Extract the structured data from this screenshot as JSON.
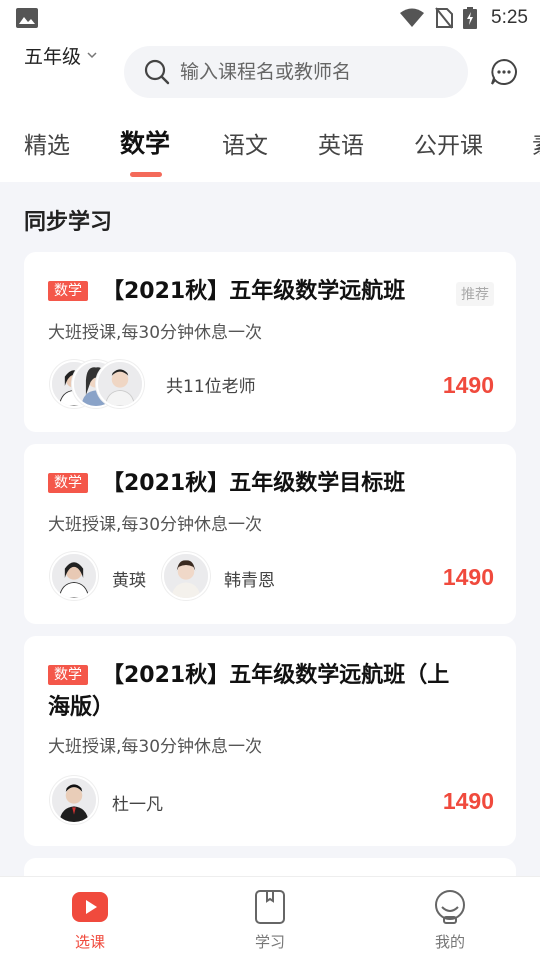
{
  "status_bar": {
    "time": "5:25"
  },
  "header": {
    "grade": "五年级",
    "search_placeholder": "输入课程名或教师名"
  },
  "tabs": [
    {
      "label": "精选",
      "active": false
    },
    {
      "label": "数学",
      "active": true
    },
    {
      "label": "语文",
      "active": false
    },
    {
      "label": "英语",
      "active": false
    },
    {
      "label": "公开课",
      "active": false
    },
    {
      "label": "素",
      "active": false
    }
  ],
  "section_title": "同步学习",
  "courses": [
    {
      "badge": "数学",
      "title": "【2021秋】五年级数学远航班",
      "tag": "推荐",
      "desc": "大班授课,每30分钟休息一次",
      "teachers_text": "共11位老师",
      "price": "1490"
    },
    {
      "badge": "数学",
      "title": "【2021秋】五年级数学目标班",
      "desc": "大班授课,每30分钟休息一次",
      "teachers": [
        "黄瑛",
        "韩青恩"
      ],
      "price": "1490"
    },
    {
      "badge": "数学",
      "title": "【2021秋】五年级数学远航班（上海版）",
      "desc": "大班授课,每30分钟休息一次",
      "teachers": [
        "杜一凡"
      ],
      "price": "1490"
    }
  ],
  "bottom_nav": [
    {
      "label": "选课",
      "icon": "play-icon",
      "active": true
    },
    {
      "label": "学习",
      "icon": "book-icon",
      "active": false
    },
    {
      "label": "我的",
      "icon": "profile-icon",
      "active": false
    }
  ],
  "colors": {
    "accent": "#f04a3d",
    "badge": "#f4574a",
    "background": "#f4f5f9"
  }
}
